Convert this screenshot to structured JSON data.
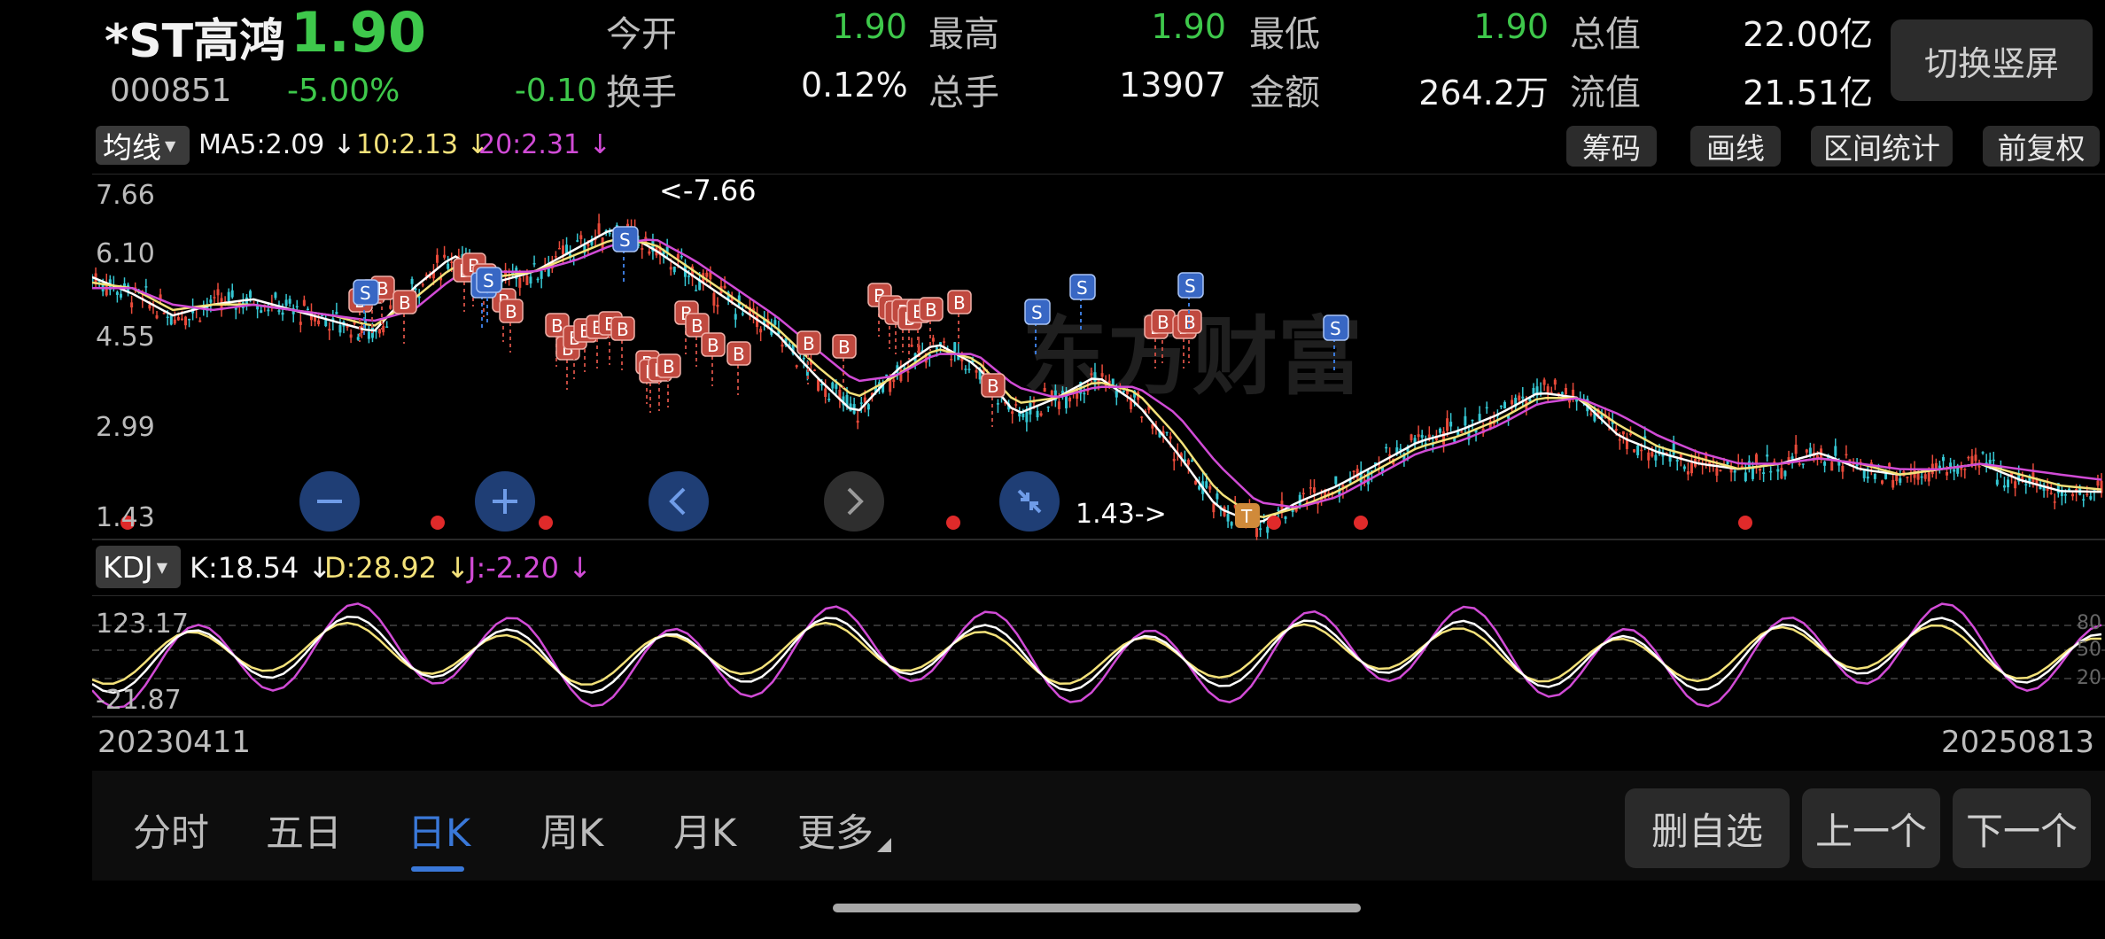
{
  "header": {
    "name": "*ST高鸿",
    "code": "000851",
    "price": "1.90",
    "change_pct": "-5.00%",
    "change": "-0.10",
    "stats": [
      {
        "label": "今开",
        "value": "1.90",
        "color": "green"
      },
      {
        "label": "最高",
        "value": "1.90",
        "color": "green"
      },
      {
        "label": "最低",
        "value": "1.90",
        "color": "green"
      },
      {
        "label": "总值",
        "value": "22.00亿",
        "color": "white"
      },
      {
        "label": "换手",
        "value": "0.12%",
        "color": "white"
      },
      {
        "label": "总手",
        "value": "13907",
        "color": "white"
      },
      {
        "label": "金额",
        "value": "264.2万",
        "color": "white"
      },
      {
        "label": "流值",
        "value": "21.51亿",
        "color": "white"
      }
    ],
    "switch_button": "切换竖屏"
  },
  "ma_bar": {
    "selector": "均线",
    "ma5": "MA5:2.09 ↓",
    "ma10": "10:2.13 ↓",
    "ma20": "20:2.31 ↓",
    "buttons": [
      "筹码",
      "画线",
      "区间统计",
      "前复权"
    ]
  },
  "price_chart": {
    "y_labels": [
      "7.66",
      "6.10",
      "4.55",
      "2.99",
      "1.43"
    ],
    "max_label": "<-7.66",
    "min_label": "1.43->",
    "watermark": "东方财富",
    "marker_b": "B",
    "marker_s": "S",
    "marker_t": "T"
  },
  "controls": [
    "minus-icon",
    "plus-icon",
    "chevron-left-icon",
    "chevron-right-icon",
    "collapse-icon"
  ],
  "kdj_bar": {
    "selector": "KDJ",
    "k": "K:18.54 ↓",
    "d": "D:28.92 ↓",
    "j": "J:-2.20 ↓"
  },
  "kdj_chart": {
    "y_top": "123.17",
    "y_bottom": "-21.87",
    "right_labels": [
      "80",
      "50",
      "20"
    ]
  },
  "dates": {
    "start": "20230411",
    "end": "20250813"
  },
  "tabs": [
    "分时",
    "五日",
    "日K",
    "周K",
    "月K",
    "更多"
  ],
  "active_tab": "日K",
  "bottom_buttons": [
    "删自选",
    "上一个",
    "下一个"
  ],
  "colors": {
    "up_red": "#e84a3a",
    "down_green": "#3ec84b",
    "ma5_white": "#ffffff",
    "ma10_yellow": "#f4e27a",
    "ma20_magenta": "#d14bd6",
    "accent_blue": "#3a78d8",
    "b_marker": "#c0493f",
    "s_marker": "#3867c4"
  },
  "chart_data": {
    "type": "line",
    "title": "",
    "x_range": [
      "20230411",
      "20250813"
    ],
    "ylim": [
      1.43,
      7.66
    ],
    "series": [
      {
        "name": "MA5",
        "values": [
          6.0,
          5.7,
          5.3,
          5.5,
          5.6,
          5.4,
          5.2,
          5.0,
          5.8,
          6.4,
          5.9,
          6.1,
          6.5,
          6.9,
          6.5,
          6.0,
          5.5,
          5.0,
          4.2,
          3.5,
          4.3,
          4.8,
          4.4,
          3.5,
          3.8,
          4.2,
          3.7,
          2.8,
          1.8,
          1.5,
          1.9,
          2.2,
          2.6,
          3.0,
          3.2,
          3.5,
          3.9,
          3.8,
          3.1,
          2.8,
          2.6,
          2.5,
          2.6,
          2.8,
          2.5,
          2.4,
          2.5,
          2.6,
          2.3,
          2.1,
          2.09
        ]
      },
      {
        "name": "10",
        "values": [
          5.9,
          5.8,
          5.4,
          5.5,
          5.5,
          5.4,
          5.3,
          5.1,
          5.6,
          6.2,
          6.0,
          6.1,
          6.4,
          6.7,
          6.6,
          6.1,
          5.6,
          5.1,
          4.4,
          3.8,
          4.2,
          4.7,
          4.5,
          3.7,
          3.8,
          4.1,
          3.9,
          3.1,
          2.1,
          1.6,
          1.8,
          2.1,
          2.5,
          2.9,
          3.1,
          3.4,
          3.8,
          3.8,
          3.3,
          2.9,
          2.7,
          2.5,
          2.6,
          2.7,
          2.6,
          2.4,
          2.5,
          2.6,
          2.4,
          2.2,
          2.13
        ]
      },
      {
        "name": "20",
        "values": [
          5.8,
          5.8,
          5.5,
          5.4,
          5.5,
          5.4,
          5.3,
          5.2,
          5.4,
          6.0,
          6.1,
          6.1,
          6.3,
          6.6,
          6.7,
          6.3,
          5.8,
          5.3,
          4.7,
          4.1,
          4.2,
          4.6,
          4.6,
          4.0,
          3.8,
          4.0,
          4.0,
          3.5,
          2.6,
          1.9,
          1.8,
          2.0,
          2.4,
          2.8,
          3.0,
          3.3,
          3.7,
          3.8,
          3.5,
          3.1,
          2.8,
          2.6,
          2.6,
          2.7,
          2.6,
          2.5,
          2.5,
          2.6,
          2.5,
          2.4,
          2.31
        ]
      }
    ]
  }
}
